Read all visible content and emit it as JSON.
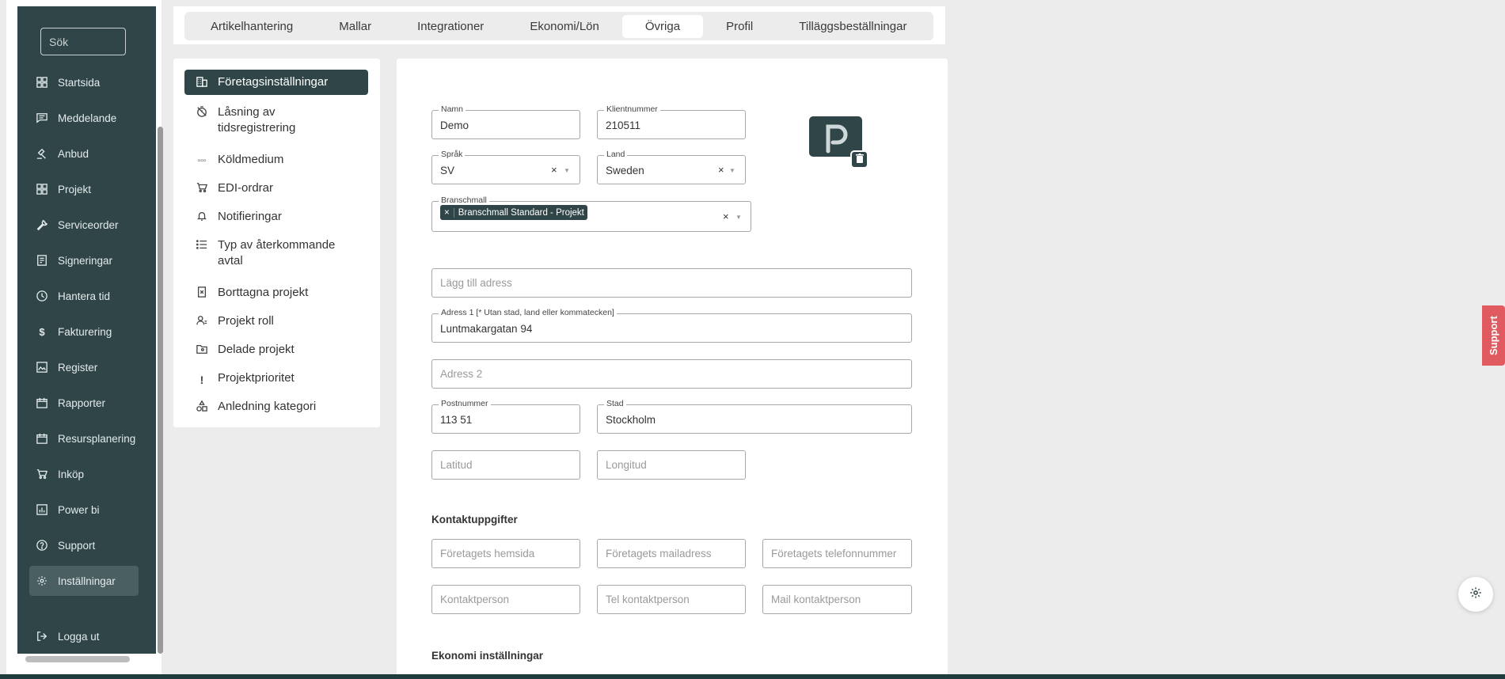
{
  "sidebar": {
    "search_placeholder": "Sök",
    "items": [
      {
        "label": "Startsida",
        "icon": "dashboard-icon"
      },
      {
        "label": "Meddelande",
        "icon": "message-icon"
      },
      {
        "label": "Anbud",
        "icon": "gavel-icon"
      },
      {
        "label": "Projekt",
        "icon": "grid-icon"
      },
      {
        "label": "Serviceorder",
        "icon": "wrench-icon"
      },
      {
        "label": "Signeringar",
        "icon": "document-sign-icon"
      },
      {
        "label": "Hantera tid",
        "icon": "clock-icon"
      },
      {
        "label": "Fakturering",
        "icon": "dollar-icon"
      },
      {
        "label": "Register",
        "icon": "image-icon"
      },
      {
        "label": "Rapporter",
        "icon": "calendar-icon"
      },
      {
        "label": "Resursplanering",
        "icon": "calendar-icon"
      },
      {
        "label": "Inköp",
        "icon": "cart-icon"
      },
      {
        "label": "Power bi",
        "icon": "bar-chart-icon"
      },
      {
        "label": "Support",
        "icon": "help-circle-icon"
      },
      {
        "label": "Inställningar",
        "icon": "gear-icon"
      }
    ],
    "logout_label": "Logga ut"
  },
  "tabs": [
    "Artikelhantering",
    "Mallar",
    "Integrationer",
    "Ekonomi/Lön",
    "Övriga",
    "Profil",
    "Tilläggsbeställningar"
  ],
  "active_tab": "Övriga",
  "settings_menu": [
    {
      "label": "Företagsinställningar",
      "icon": "building-icon"
    },
    {
      "label": "Låsning av tidsregistrering",
      "icon": "timer-off-icon"
    },
    {
      "label": "Köldmedium",
      "icon": "refrigerant-icon"
    },
    {
      "label": "EDI-ordrar",
      "icon": "cart-plus-icon"
    },
    {
      "label": "Notifieringar",
      "icon": "bell-icon"
    },
    {
      "label": "Typ av återkommande avtal",
      "icon": "list-icon"
    },
    {
      "label": "Borttagna projekt",
      "icon": "deleted-file-icon"
    },
    {
      "label": "Projekt roll",
      "icon": "user-roles-icon"
    },
    {
      "label": "Delade projekt",
      "icon": "shared-folder-icon"
    },
    {
      "label": "Projektprioritet",
      "icon": "exclamation-icon"
    },
    {
      "label": "Anledning kategori",
      "icon": "shapes-icon"
    }
  ],
  "form": {
    "name": {
      "label": "Namn",
      "value": "Demo"
    },
    "client_number": {
      "label": "Klientnummer",
      "value": "210511"
    },
    "language": {
      "label": "Språk",
      "value": "SV"
    },
    "country": {
      "label": "Land",
      "value": "Sweden"
    },
    "industry_template": {
      "label": "Branschmall",
      "chip": "Branschmall Standard - Projekt"
    },
    "add_address_placeholder": "Lägg till adress",
    "address1": {
      "label": "Adress 1 [* Utan stad, land eller kommatecken]",
      "value": "Luntmakargatan 94"
    },
    "address2_placeholder": "Adress 2",
    "postal_code": {
      "label": "Postnummer",
      "value": "113 51"
    },
    "city": {
      "label": "Stad",
      "value": "Stockholm"
    },
    "latitude_placeholder": "Latitud",
    "longitude_placeholder": "Longitud",
    "contact_section_title": "Kontaktuppgifter",
    "website_placeholder": "Företagets hemsida",
    "email_placeholder": "Företagets mailadress",
    "phone_placeholder": "Företagets telefonnummer",
    "contact_person_placeholder": "Kontaktperson",
    "contact_phone_placeholder": "Tel kontaktperson",
    "contact_email_placeholder": "Mail kontaktperson",
    "economy_section_title": "Ekonomi inställningar",
    "clear_symbol": "×"
  },
  "support_tab_label": "Support",
  "colors": {
    "sidebar": "#2f4548",
    "accent_support": "#e05a5f",
    "background": "#ececec"
  }
}
